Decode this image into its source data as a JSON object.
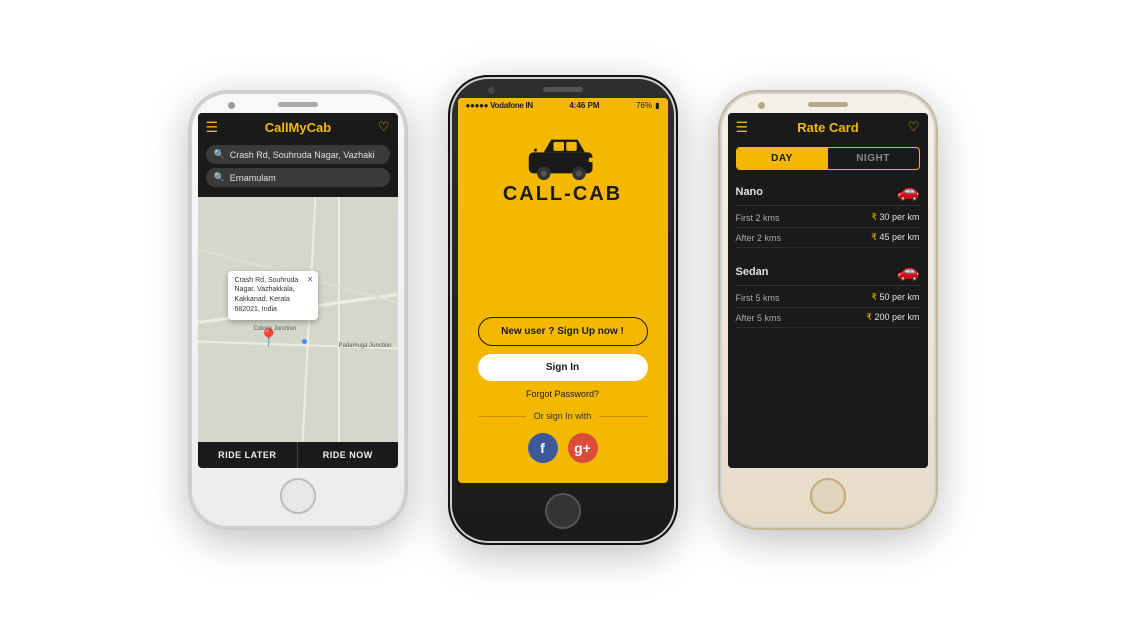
{
  "background": "#ffffff",
  "phone1": {
    "title": "CallMyCab",
    "search1": "Crash Rd, Souhruda Nagar, Vazhaki",
    "search2": "Ernamulam",
    "popup_text": "Crash Rd, Souhruda Nagar, Vazhakkala, Kakkanad, Kerala 682021, India",
    "btn_left": "RIDE LATER",
    "btn_right": "RIDE NOW",
    "map_label1": "Padamuga Junction",
    "map_label2": "Colony Junction"
  },
  "phone2": {
    "status_left": "●●●●● Vodafone IN",
    "status_center": "4:46 PM",
    "status_right": "76%",
    "logo_part1": "CALL",
    "logo_dash": "-",
    "logo_part2": "CAB",
    "btn_signup": "New user ? Sign Up now !",
    "btn_signin": "Sign In",
    "forgot": "Forgot Password?",
    "divider_text": "Or sign In with"
  },
  "phone3": {
    "title": "Rate Card",
    "tab_day": "DAY",
    "tab_night": "NIGHT",
    "vehicles": [
      {
        "name": "Nano",
        "rates": [
          {
            "label": "First 2 kms",
            "value": "₹ 30 per km"
          },
          {
            "label": "After 2 kms",
            "value": "₹ 45 per km"
          }
        ]
      },
      {
        "name": "Sedan",
        "rates": [
          {
            "label": "First 5 kms",
            "value": "₹ 50 per km"
          },
          {
            "label": "After 5 kms",
            "value": "₹ 200 per km"
          }
        ]
      }
    ]
  }
}
